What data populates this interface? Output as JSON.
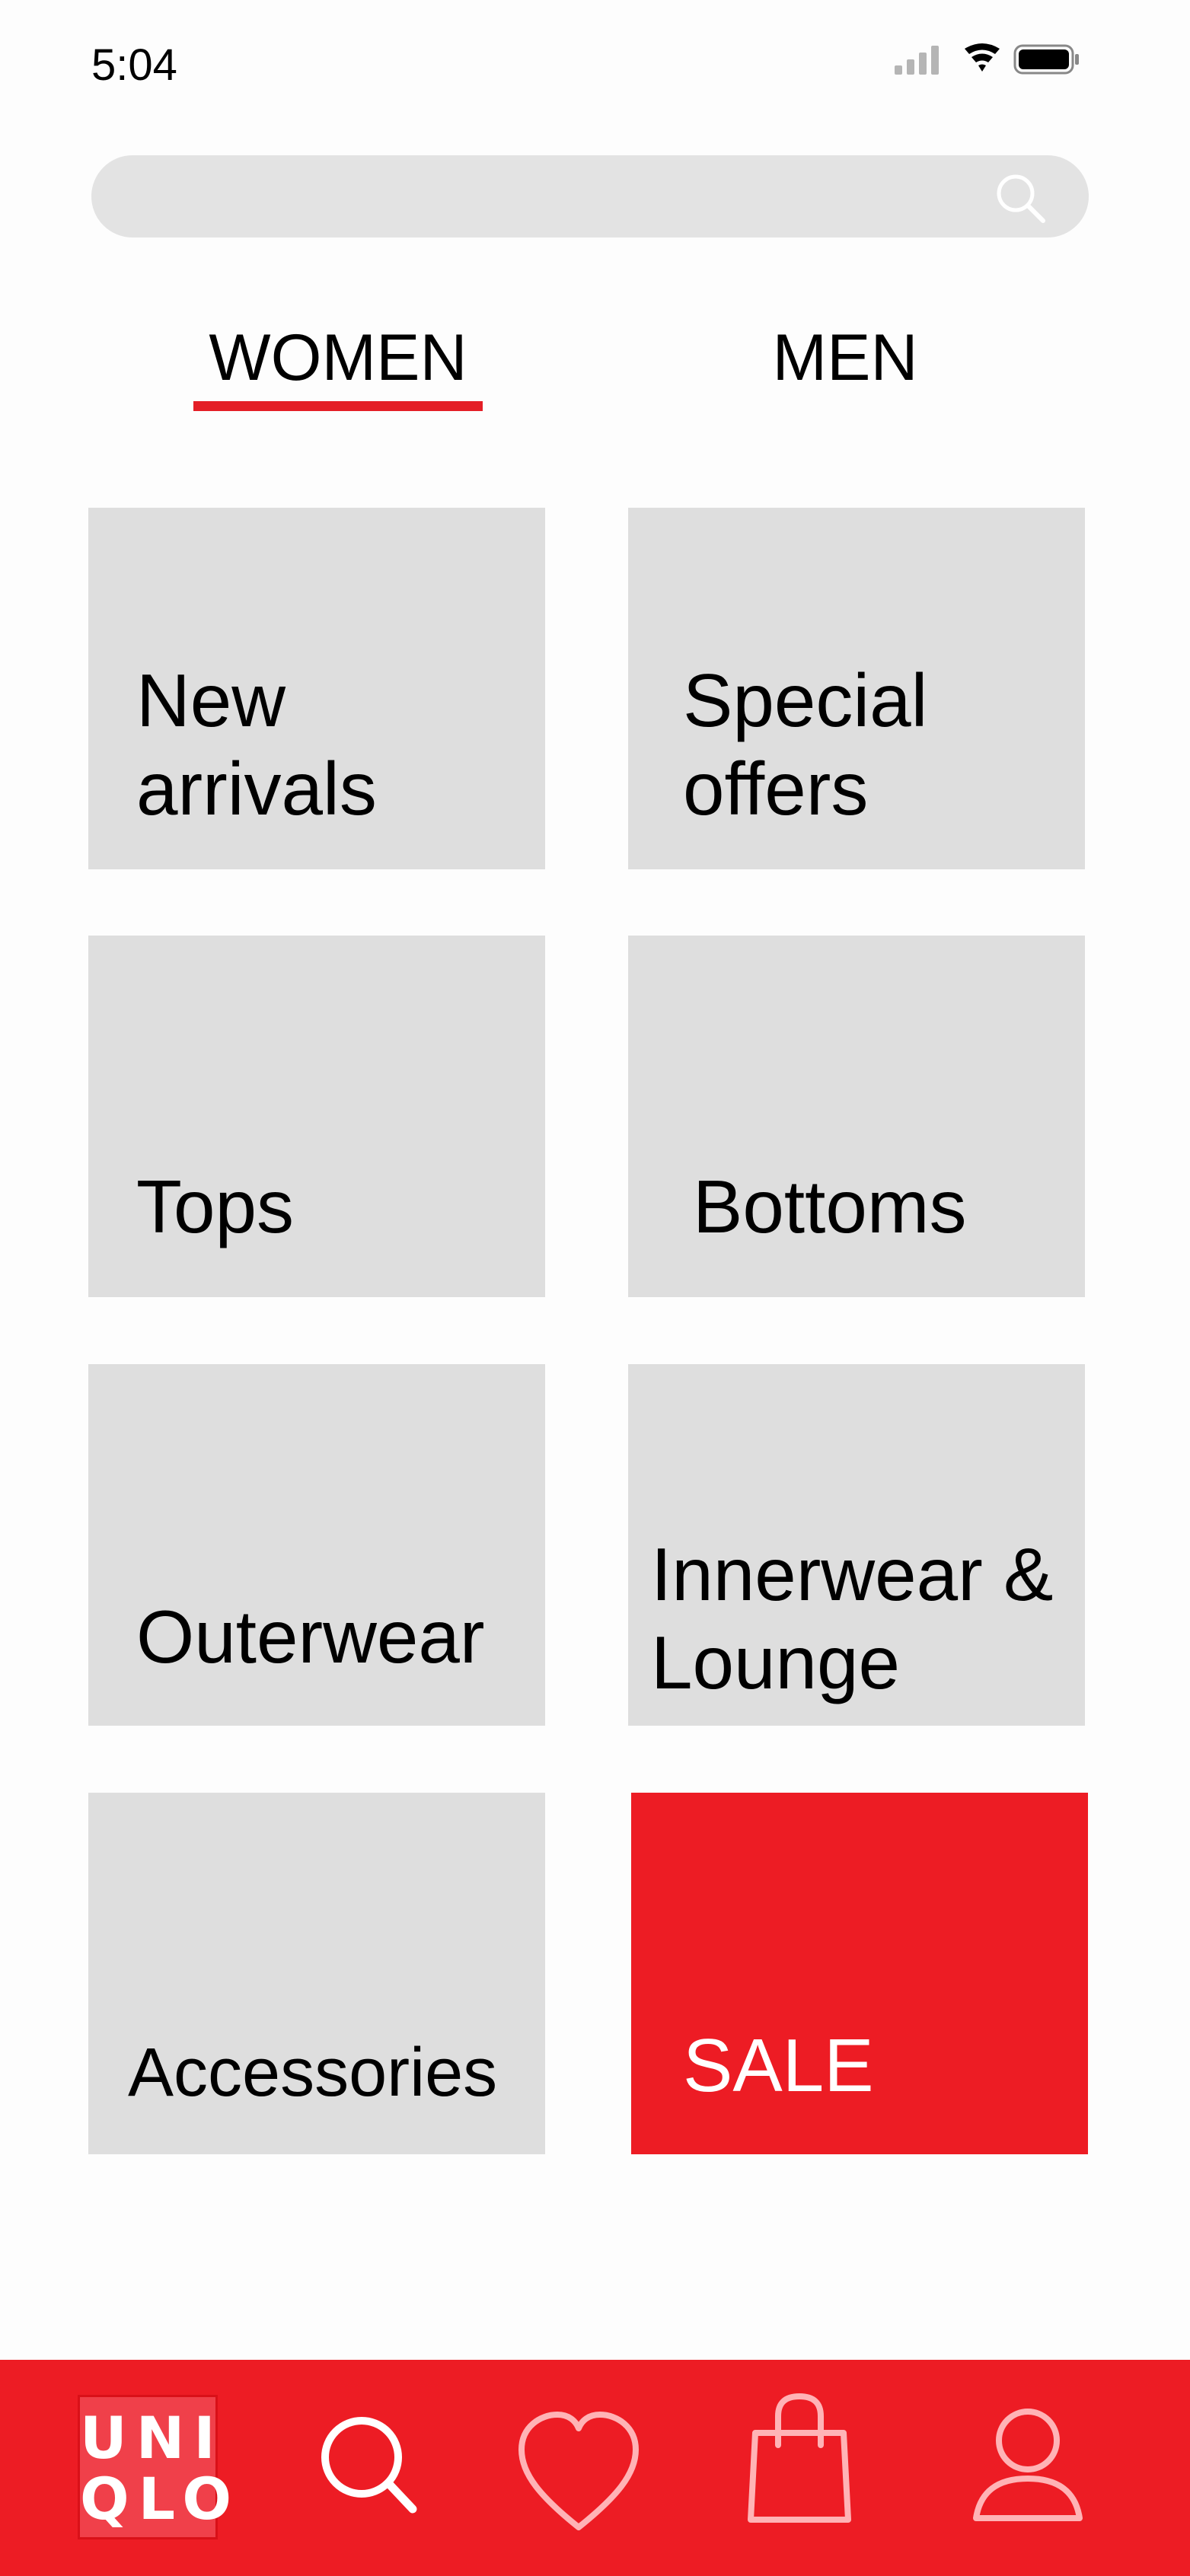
{
  "status_bar": {
    "time": "5:04",
    "icons": [
      "cellular-signal-icon",
      "wifi-icon",
      "battery-icon"
    ]
  },
  "search": {
    "placeholder": "",
    "value": "",
    "icon": "search-icon"
  },
  "tabs": [
    {
      "label": "WOMEN",
      "selected": true
    },
    {
      "label": "MEN",
      "selected": false
    }
  ],
  "categories": [
    {
      "line1": "New",
      "line2": "arrivals"
    },
    {
      "line1": "Special",
      "line2": "offers"
    },
    {
      "line1": "Tops"
    },
    {
      "line1": "Bottoms"
    },
    {
      "line1": "Outerwear"
    },
    {
      "line1": "Innerwear &",
      "line2": "Lounge"
    },
    {
      "line1": "Accessories"
    },
    {
      "line1": "SALE"
    }
  ],
  "bottom_nav": {
    "logo": {
      "line1": "UNI",
      "line2": "QLO"
    },
    "items": [
      "home-logo",
      "search-icon",
      "heart-icon",
      "shopping-bag-icon",
      "profile-icon"
    ]
  },
  "colors": {
    "brand_red": "#ed1c24",
    "tile_gray": "#dedede",
    "search_gray": "#e3e3e3"
  }
}
